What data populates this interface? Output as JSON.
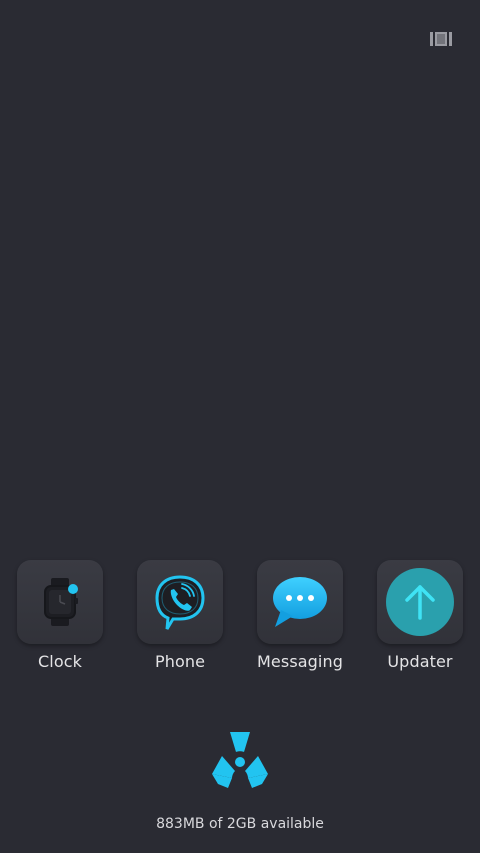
{
  "apps": [
    {
      "id": "clock",
      "label": "Clock",
      "icon": "smartwatch-icon",
      "badge": true
    },
    {
      "id": "phone",
      "label": "Phone",
      "icon": "phone-bubble-icon"
    },
    {
      "id": "messaging",
      "label": "Messaging",
      "icon": "chat-bubble-icon"
    },
    {
      "id": "updater",
      "label": "Updater",
      "icon": "arrow-up-icon"
    }
  ],
  "storage": {
    "text": "883MB of 2GB available"
  },
  "colors": {
    "background": "#2a2b33",
    "accent": "#22c4f0",
    "updater_circle": "#2aa0ad",
    "label": "#e4e4e6"
  }
}
